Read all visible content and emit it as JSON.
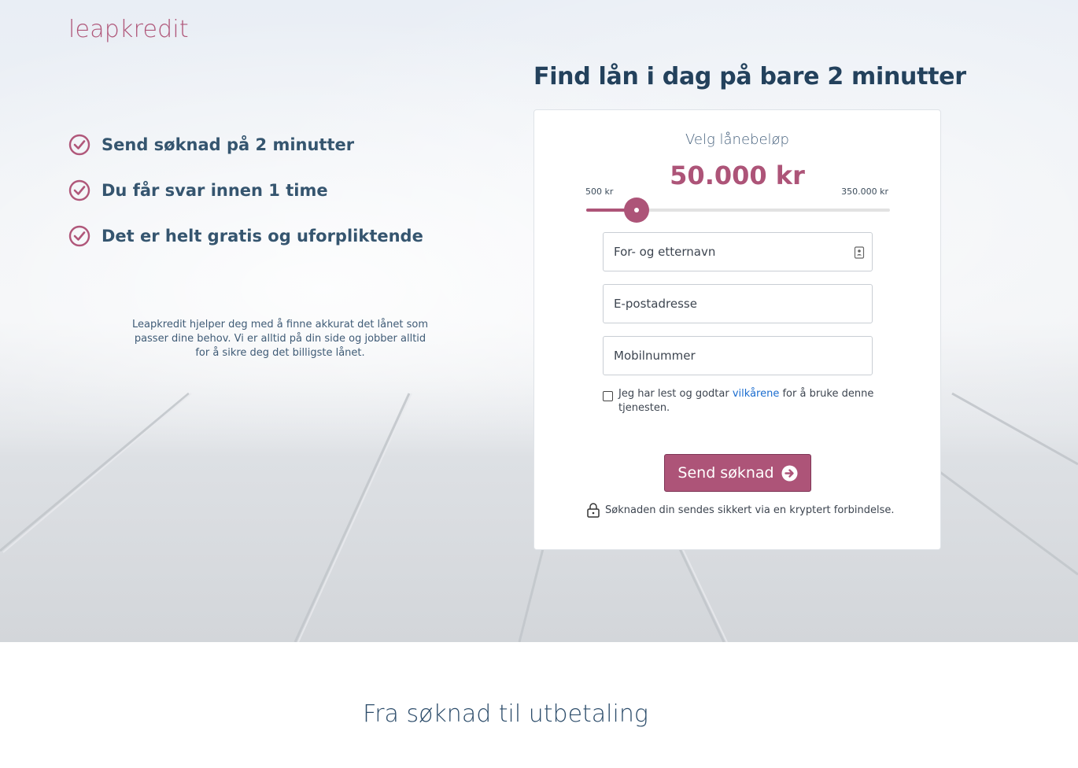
{
  "brand": {
    "logo": "leapkredit"
  },
  "benefits": [
    {
      "label": "Send søknad på 2 minutter"
    },
    {
      "label": "Du får svar innen 1 time"
    },
    {
      "label": "Det er helt gratis og uforpliktende"
    }
  ],
  "about_text": "Leapkredit hjelper deg med å finne akkurat det lånet som passer dine behov. Vi er alltid på din side og jobber alltid for å sikre deg det billigste lånet.",
  "headline": "Find lån i dag på bare 2 minutter",
  "loan_form": {
    "amount_label": "Velg lånebeløp",
    "amount_value": "50.000 kr",
    "min_label": "500 kr",
    "max_label": "350.000 kr",
    "slider_fraction": 0.167,
    "name_placeholder": "For- og etternavn",
    "email_placeholder": "E-postadresse",
    "phone_placeholder": "Mobilnummer",
    "terms_before": "Jeg har lest og godtar ",
    "terms_link": "vilkårene",
    "terms_after": " for å bruke denne tjenesten.",
    "terms_checked": false,
    "submit_label": "Send søknad",
    "secure_text": "Søknaden din sendes sikkert via en kryptert forbindelse."
  },
  "section_title": "Fra søknad til utbetaling",
  "colors": {
    "accent": "#ad5478",
    "heading": "#23415c",
    "link": "#1a6ccf"
  }
}
